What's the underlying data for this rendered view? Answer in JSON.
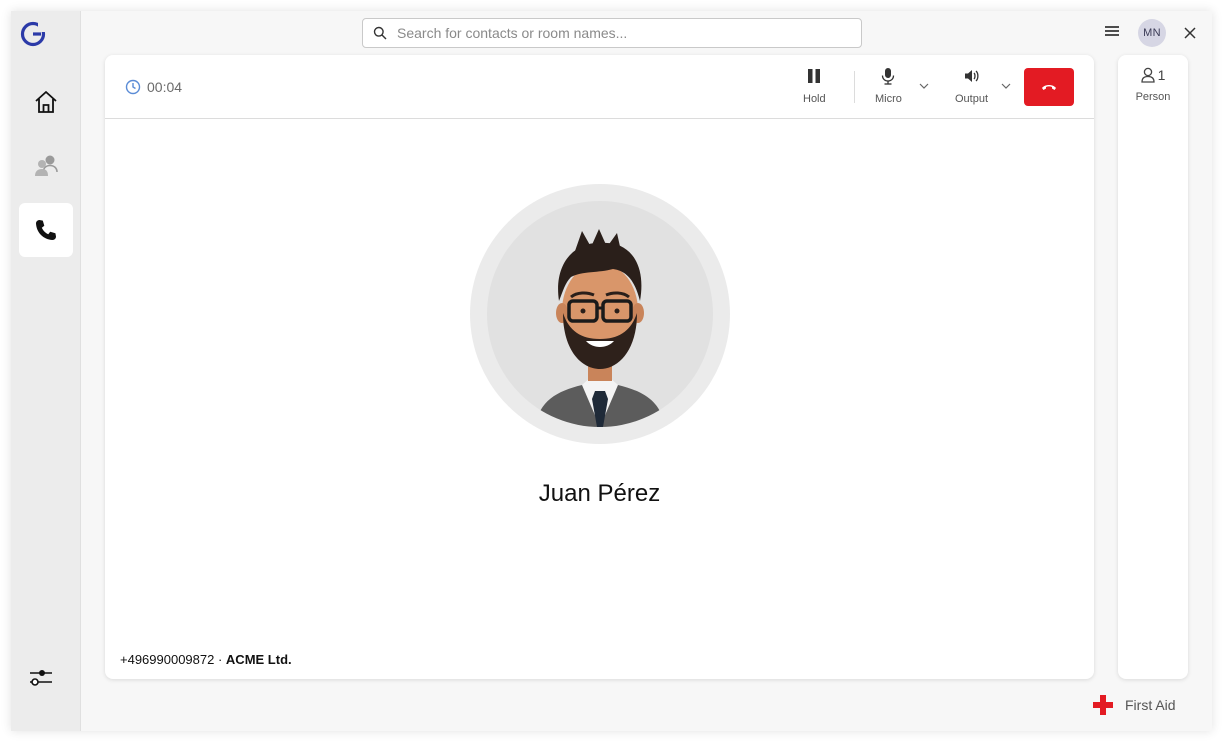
{
  "search": {
    "placeholder": "Search for contacts or room names..."
  },
  "user": {
    "initials": "MN"
  },
  "call": {
    "timer": "00:04",
    "controls": {
      "hold": "Hold",
      "micro": "Micro",
      "output": "Output"
    },
    "caller_name": "Juan Pérez",
    "caller_phone": "+496990009872 ·",
    "caller_company": "ACME Ltd."
  },
  "participants": {
    "count": "1",
    "label": "Person"
  },
  "footer": {
    "first_aid": "First Aid"
  },
  "colors": {
    "accent": "#2b3aa8",
    "hangup": "#e31b23",
    "first_aid": "#e31b23"
  },
  "icons": [
    "app-logo-icon",
    "home-icon",
    "contacts-icon",
    "phone-icon",
    "sliders-icon",
    "search-icon",
    "menu-icon",
    "close-icon",
    "clock-icon",
    "pause-icon",
    "microphone-icon",
    "speaker-icon",
    "hangup-icon",
    "person-icon",
    "red-cross-icon"
  ]
}
